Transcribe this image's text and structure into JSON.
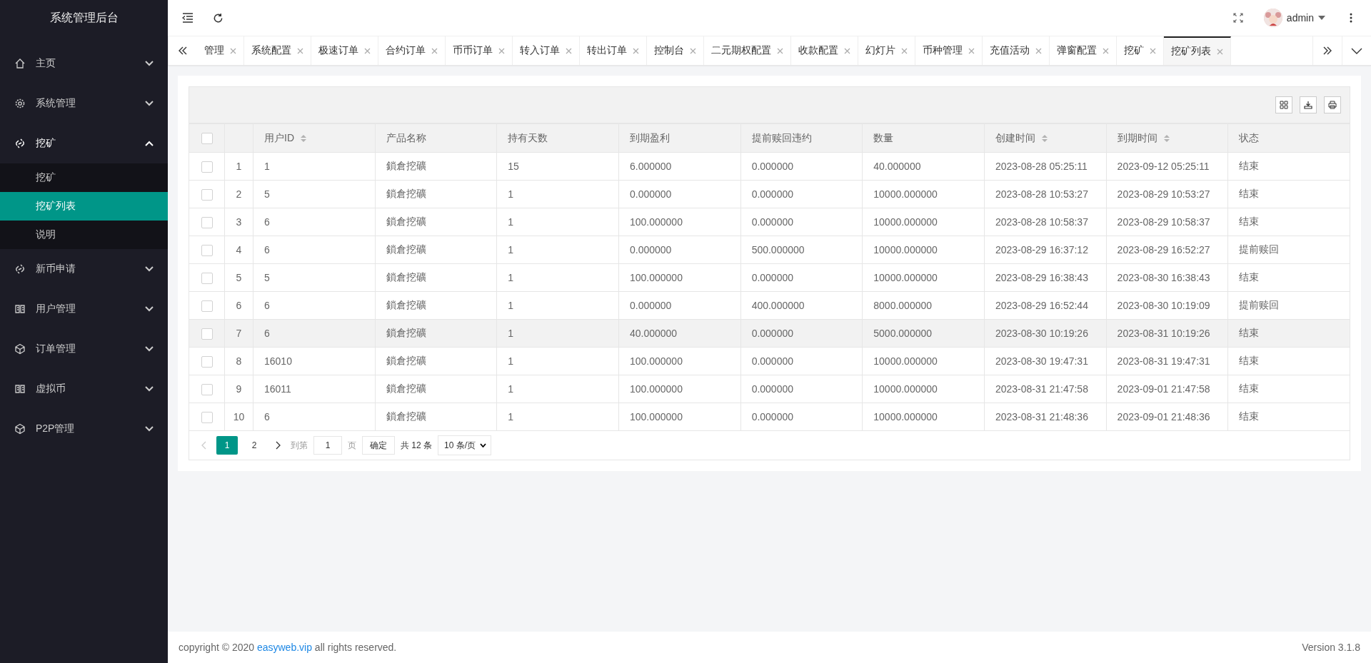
{
  "sidebar": {
    "title": "系统管理后台",
    "items": [
      {
        "label": "主页",
        "kind": "home",
        "expanded": false
      },
      {
        "label": "系统管理",
        "kind": "gear",
        "expanded": false
      },
      {
        "label": "挖矿",
        "kind": "link",
        "expanded": true,
        "children": [
          {
            "label": "挖矿",
            "selected": false
          },
          {
            "label": "挖矿列表",
            "selected": true
          },
          {
            "label": "说明",
            "selected": false
          }
        ]
      },
      {
        "label": "新币申请",
        "kind": "link",
        "expanded": false
      },
      {
        "label": "用户管理",
        "kind": "book",
        "expanded": false
      },
      {
        "label": "订单管理",
        "kind": "cube",
        "expanded": false
      },
      {
        "label": "虚拟币",
        "kind": "book",
        "expanded": false
      },
      {
        "label": "P2P管理",
        "kind": "cube",
        "expanded": false
      }
    ]
  },
  "header": {
    "user": "admin"
  },
  "tabs": [
    {
      "label": "管理",
      "selected": false
    },
    {
      "label": "系统配置",
      "selected": false
    },
    {
      "label": "极速订单",
      "selected": false
    },
    {
      "label": "合约订单",
      "selected": false
    },
    {
      "label": "币币订单",
      "selected": false
    },
    {
      "label": "转入订单",
      "selected": false
    },
    {
      "label": "转出订单",
      "selected": false
    },
    {
      "label": "控制台",
      "selected": false
    },
    {
      "label": "二元期权配置",
      "selected": false
    },
    {
      "label": "收款配置",
      "selected": false
    },
    {
      "label": "幻灯片",
      "selected": false
    },
    {
      "label": "币种管理",
      "selected": false
    },
    {
      "label": "充值活动",
      "selected": false
    },
    {
      "label": "弹窗配置",
      "selected": false
    },
    {
      "label": "挖矿",
      "selected": false
    },
    {
      "label": "挖矿列表",
      "selected": true
    }
  ],
  "table": {
    "select_all_checked": false,
    "columns": [
      {
        "label": "用户ID",
        "sortable": true
      },
      {
        "label": "产品名称",
        "sortable": false
      },
      {
        "label": "持有天数",
        "sortable": false
      },
      {
        "label": "到期盈利",
        "sortable": false
      },
      {
        "label": "提前赎回违约",
        "sortable": false
      },
      {
        "label": "数量",
        "sortable": false
      },
      {
        "label": "创建时间",
        "sortable": true
      },
      {
        "label": "到期时间",
        "sortable": true
      },
      {
        "label": "状态",
        "sortable": false
      }
    ],
    "rows": [
      {
        "index": "1",
        "checked": false,
        "highlighted": false,
        "cells": [
          "1",
          "鎖倉挖礦",
          "15",
          "6.000000",
          "0.000000",
          "40.000000",
          "2023-08-28 05:25:11",
          "2023-09-12 05:25:11",
          "结束"
        ]
      },
      {
        "index": "2",
        "checked": false,
        "highlighted": false,
        "cells": [
          "5",
          "鎖倉挖礦",
          "1",
          "0.000000",
          "0.000000",
          "10000.000000",
          "2023-08-28 10:53:27",
          "2023-08-29 10:53:27",
          "结束"
        ]
      },
      {
        "index": "3",
        "checked": false,
        "highlighted": false,
        "cells": [
          "6",
          "鎖倉挖礦",
          "1",
          "100.000000",
          "0.000000",
          "10000.000000",
          "2023-08-28 10:58:37",
          "2023-08-29 10:58:37",
          "结束"
        ]
      },
      {
        "index": "4",
        "checked": false,
        "highlighted": false,
        "cells": [
          "6",
          "鎖倉挖礦",
          "1",
          "0.000000",
          "500.000000",
          "10000.000000",
          "2023-08-29 16:37:12",
          "2023-08-29 16:52:27",
          "提前赎回"
        ]
      },
      {
        "index": "5",
        "checked": false,
        "highlighted": false,
        "cells": [
          "5",
          "鎖倉挖礦",
          "1",
          "100.000000",
          "0.000000",
          "10000.000000",
          "2023-08-29 16:38:43",
          "2023-08-30 16:38:43",
          "结束"
        ]
      },
      {
        "index": "6",
        "checked": false,
        "highlighted": false,
        "cells": [
          "6",
          "鎖倉挖礦",
          "1",
          "0.000000",
          "400.000000",
          "8000.000000",
          "2023-08-29 16:52:44",
          "2023-08-30 10:19:09",
          "提前赎回"
        ]
      },
      {
        "index": "7",
        "checked": false,
        "highlighted": true,
        "cells": [
          "6",
          "鎖倉挖礦",
          "1",
          "40.000000",
          "0.000000",
          "5000.000000",
          "2023-08-30 10:19:26",
          "2023-08-31 10:19:26",
          "结束"
        ]
      },
      {
        "index": "8",
        "checked": false,
        "highlighted": false,
        "cells": [
          "16010",
          "鎖倉挖礦",
          "1",
          "100.000000",
          "0.000000",
          "10000.000000",
          "2023-08-30 19:47:31",
          "2023-08-31 19:47:31",
          "结束"
        ]
      },
      {
        "index": "9",
        "checked": false,
        "highlighted": false,
        "cells": [
          "16011",
          "鎖倉挖礦",
          "1",
          "100.000000",
          "0.000000",
          "10000.000000",
          "2023-08-31 21:47:58",
          "2023-09-01 21:47:58",
          "结束"
        ]
      },
      {
        "index": "10",
        "checked": false,
        "highlighted": false,
        "cells": [
          "6",
          "鎖倉挖礦",
          "1",
          "100.000000",
          "0.000000",
          "10000.000000",
          "2023-08-31 21:48:36",
          "2023-09-01 21:48:36",
          "结束"
        ]
      }
    ]
  },
  "pagination": {
    "pages": [
      {
        "label": "1",
        "selected": true
      },
      {
        "label": "2",
        "selected": false
      }
    ],
    "goto_label": "到第",
    "goto_value": "1",
    "page_unit": "页",
    "confirm": "确定",
    "total": "共 12 条",
    "page_size": "10 条/页"
  },
  "footer": {
    "copyright_before": "copyright © 2020 ",
    "link": "easyweb.vip",
    "copyright_after": " all rights reserved.",
    "version": "Version 3.1.8"
  }
}
